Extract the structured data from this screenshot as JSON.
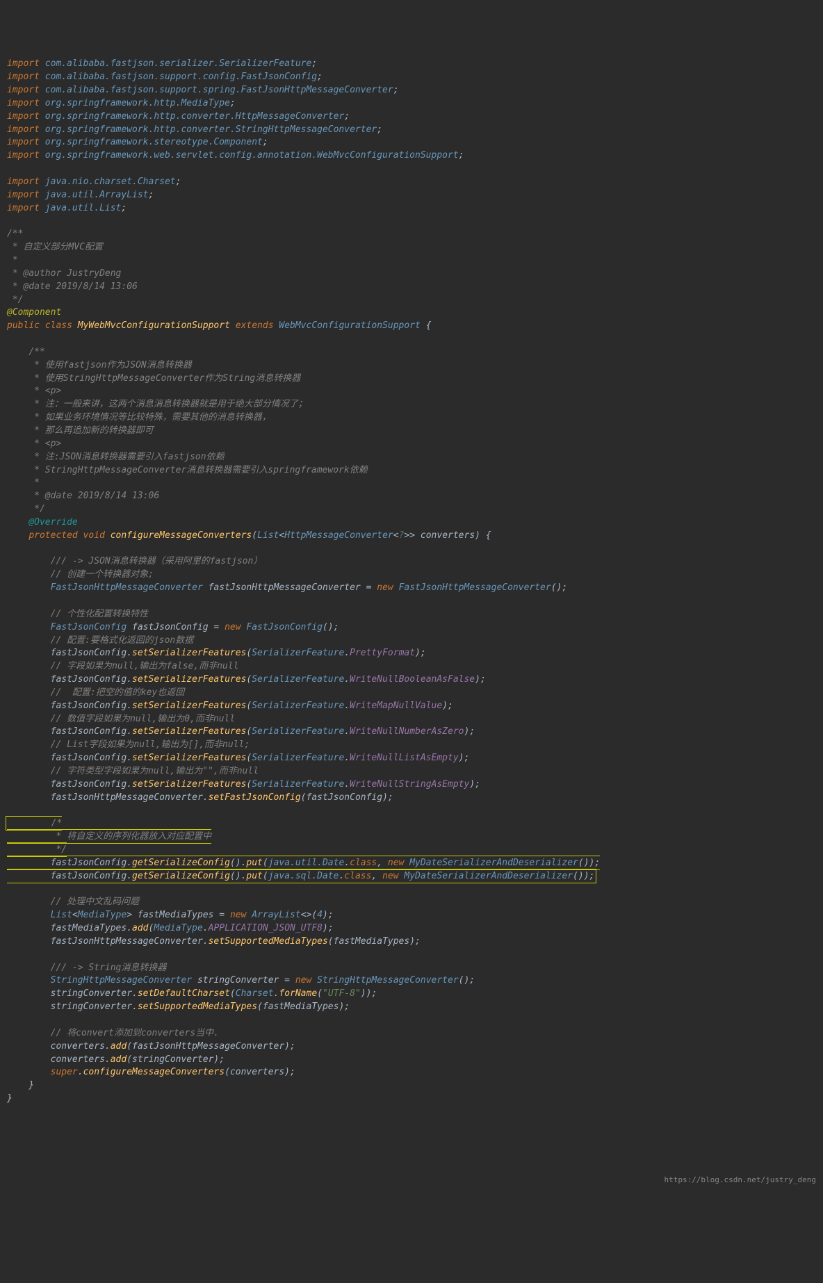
{
  "imports": [
    "com.alibaba.fastjson.serializer.SerializerFeature",
    "com.alibaba.fastjson.support.config.FastJsonConfig",
    "com.alibaba.fastjson.support.spring.FastJsonHttpMessageConverter",
    "org.springframework.http.MediaType",
    "org.springframework.http.converter.HttpMessageConverter",
    "org.springframework.http.converter.StringHttpMessageConverter",
    "org.springframework.stereotype.Component",
    "org.springframework.web.servlet.config.annotation.WebMvcConfigurationSupport",
    "java.nio.charset.Charset",
    "java.util.ArrayList",
    "java.util.List"
  ],
  "class_comment": {
    "desc": "自定义部分MVC配置",
    "author": "JustryDeng",
    "date": "2019/8/14 13:06"
  },
  "annotation": "@Component",
  "class_decl": {
    "modifier": "public",
    "kw": "class",
    "name": "MyWebMvcConfigurationSupport",
    "extends_kw": "extends",
    "extends": "WebMvcConfigurationSupport"
  },
  "method_comment": {
    "l1": "使用fastjson作为JSON消息转换器",
    "l2": "使用StringHttpMessageConverter作为String消息转换器",
    "l3": "<p>",
    "l4": "注：一般来讲，这两个消息消息转换器就是用于绝大部分情况了；",
    "l5": "如果业务环境情况等比较特殊，需要其他的消息转换器，",
    "l6": "那么再追加新的转换器即可",
    "l7": "<p>",
    "l8": "注:JSON消息转换器需要引入fastjson依赖",
    "l9": "StringHttpMessageConverter消息转换器需要引入springframework依赖",
    "date": "2019/8/14 13:06"
  },
  "override": "@Override",
  "method": {
    "modifier": "protected",
    "ret": "void",
    "name": "configureMessageConverters",
    "param_type": "List",
    "param_generic": "HttpMessageConverter",
    "param_name": "converters"
  },
  "body": {
    "c1": "/// -> JSON消息转换器（采用阿里的fastjson）",
    "c2": "// 创建一个转换器对象;",
    "l1_type": "FastJsonHttpMessageConverter",
    "l1_var": "fastJsonHttpMessageConverter",
    "l1_new": "FastJsonHttpMessageConverter",
    "c3": "// 个性化配置转换特性",
    "l2_type": "FastJsonConfig",
    "l2_var": "fastJsonConfig",
    "l2_new": "FastJsonConfig",
    "c4": "// 配置:要格式化返回的json数据",
    "sf_class": "SerializerFeature",
    "sf1": "PrettyFormat",
    "c5": "// 字段如果为null,输出为false,而非null",
    "sf2": "WriteNullBooleanAsFalse",
    "c6": "//  配置:把空的值的key也返回",
    "sf3": "WriteMapNullValue",
    "c7": "// 数值字段如果为null,输出为0,而非null",
    "sf4": "WriteNullNumberAsZero",
    "c8": "// List字段如果为null,输出为[],而非null;",
    "sf5": "WriteNullListAsEmpty",
    "c9": "// 字符类型字段如果为null,输出为\"\",而非null",
    "sf6": "WriteNullStringAsEmpty",
    "setFast": "setFastJsonConfig",
    "box_c1": "/*",
    "box_c2": " * 将自定义的序列化器放入对应配置中",
    "box_c3": " */",
    "box_l1_cls": "java.util.Date",
    "box_l2_cls": "java.sql.Date",
    "box_ser": "MyDateSerializerAndDeserializer",
    "c10": "// 处理中文乱码问题",
    "l3_type": "List",
    "l3_gen": "MediaType",
    "l3_var": "fastMediaTypes",
    "l3_new": "ArrayList",
    "l3_cap": "4",
    "mt_const": "APPLICATION_JSON_UTF8",
    "setSup": "setSupportedMediaTypes",
    "c11": "/// -> String消息转换器",
    "l4_type": "StringHttpMessageConverter",
    "l4_var": "stringConverter",
    "charset": "Charset",
    "forName": "forName",
    "utf8": "\"UTF-8\"",
    "c12": "// 将convert添加到converters当中.",
    "super": "super"
  },
  "watermark": "https://blog.csdn.net/justry_deng"
}
